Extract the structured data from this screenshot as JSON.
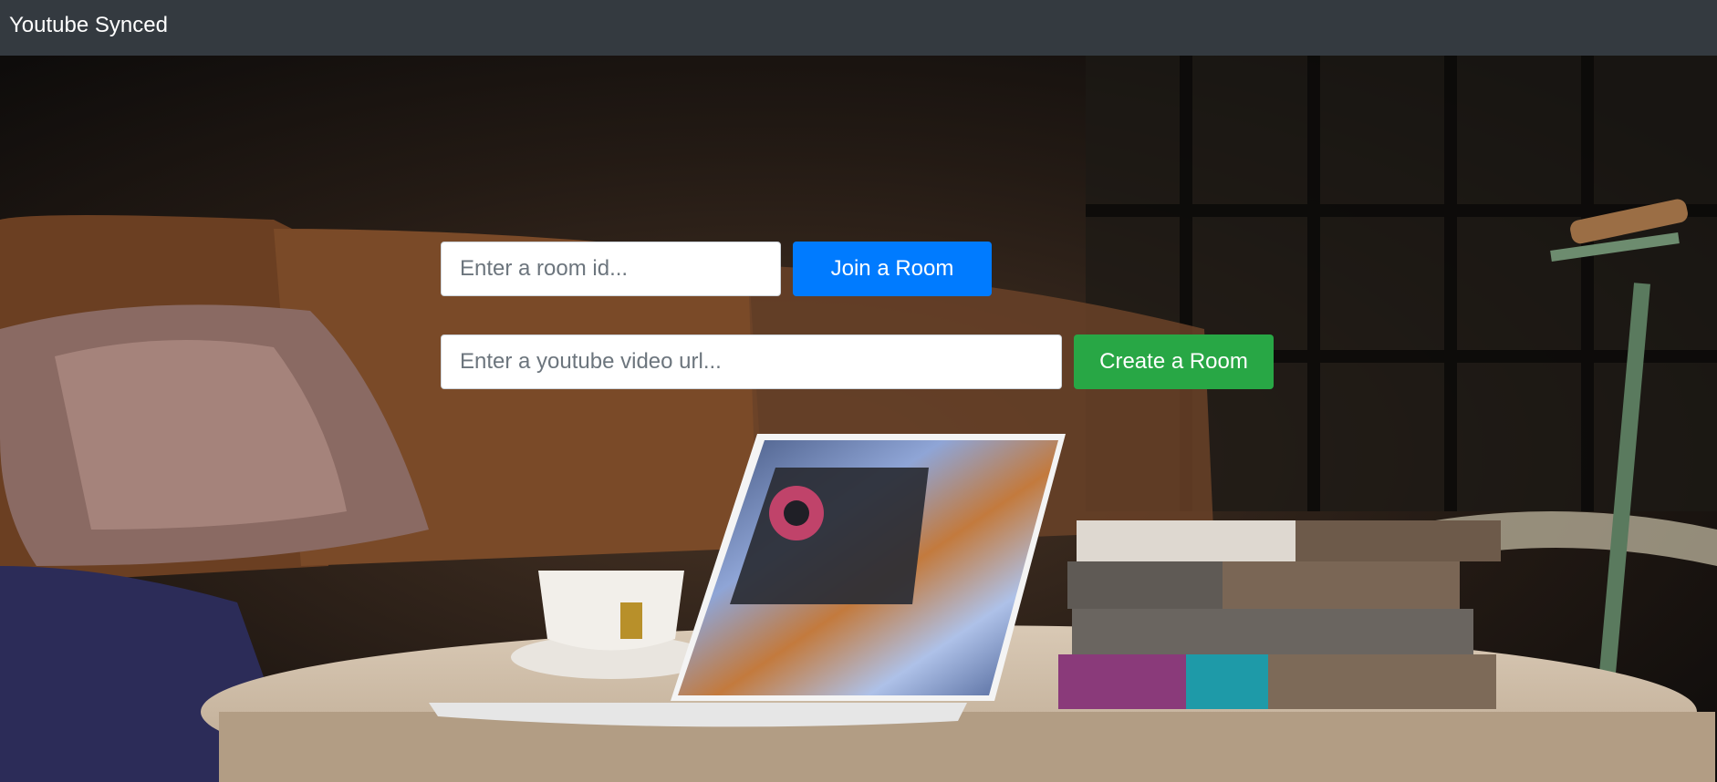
{
  "navbar": {
    "brand": "Youtube Synced"
  },
  "join_form": {
    "room_id_placeholder": "Enter a room id...",
    "join_button": "Join a Room"
  },
  "create_form": {
    "video_url_placeholder": "Enter a youtube video url...",
    "create_button": "Create a Room"
  },
  "colors": {
    "navbar_bg": "#343a40",
    "join_button": "#007bff",
    "create_button": "#28a745"
  }
}
